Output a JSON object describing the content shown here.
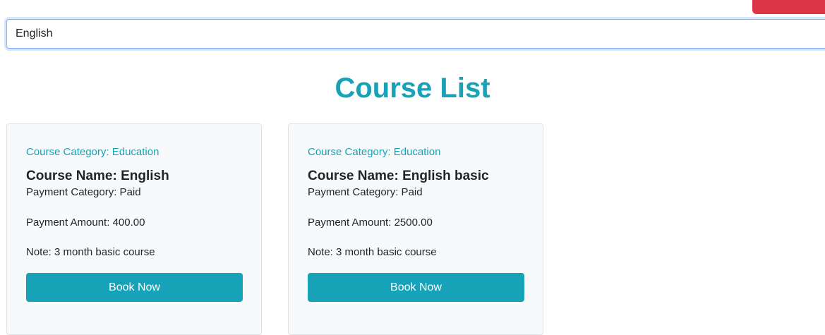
{
  "search": {
    "value": "English",
    "accent_color": "#86b7fe"
  },
  "header": {
    "title": "Course List",
    "title_color": "#17a2b8",
    "top_bar_color": "#dc3545"
  },
  "courses": [
    {
      "category": "Course Category: Education",
      "name": "Course Name: English",
      "payment_category": "Payment Category: Paid",
      "payment_amount": "Payment Amount: 400.00",
      "note": "Note: 3 month basic course",
      "button_label": "Book Now"
    },
    {
      "category": "Course Category: Education",
      "name": "Course Name: English basic",
      "payment_category": "Payment Category: Paid",
      "payment_amount": "Payment Amount: 2500.00",
      "note": "Note: 3 month basic course",
      "button_label": "Book Now"
    }
  ],
  "theme": {
    "accent": "#17a2b8",
    "card_background": "#f8f9fa"
  }
}
